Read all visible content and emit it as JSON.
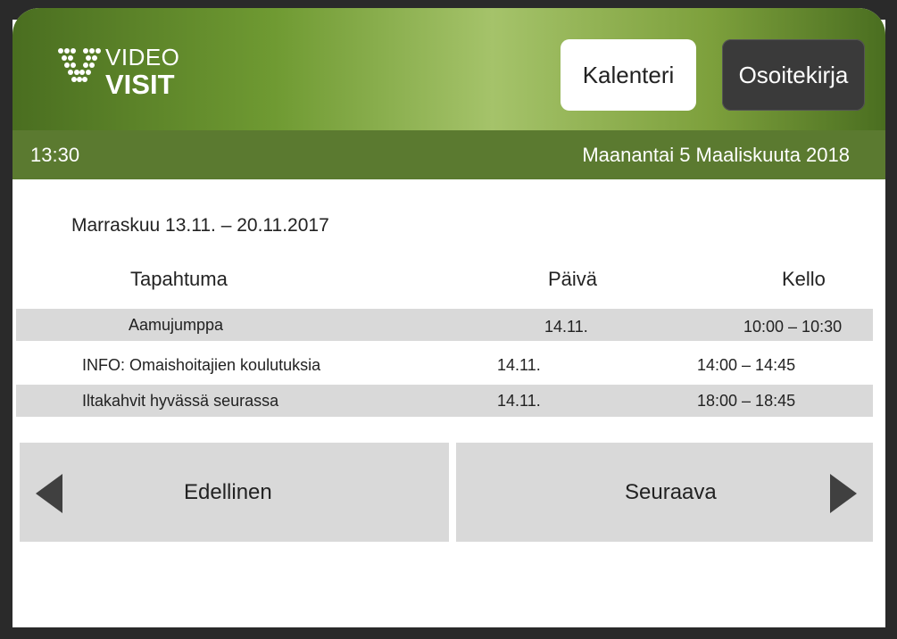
{
  "app": {
    "logo_top": "VIDEO",
    "logo_bottom": "VISIT"
  },
  "header": {
    "calendar_button": "Kalenteri",
    "addressbook_button": "Osoitekirja"
  },
  "status": {
    "time": "13:30",
    "date": "Maanantai 5 Maaliskuuta 2018"
  },
  "calendar": {
    "week_label": "Marraskuu 13.11. – 20.11.2017",
    "columns": {
      "event": "Tapahtuma",
      "day": "Päivä",
      "time": "Kello"
    },
    "events": [
      {
        "event": "Aamujumppa",
        "day": "14.11.",
        "time": "10:00 – 10:30"
      },
      {
        "event": "INFO: Omaishoitajien koulutuksia",
        "day": "14.11.",
        "time": "14:00 – 14:45"
      },
      {
        "event": "Iltakahvit hyvässä seurassa",
        "day": "14.11.",
        "time": "18:00 – 18:45"
      }
    ]
  },
  "nav": {
    "prev_label": "Edellinen",
    "next_label": "Seuraava"
  },
  "colors": {
    "header_green": "#5b7a30",
    "row_gray": "#d9d9d9",
    "dark_button": "#3a3a3a"
  },
  "icons": {
    "logo": "video-visit-logo-icon",
    "prev": "triangle-left-icon",
    "next": "triangle-right-icon"
  }
}
